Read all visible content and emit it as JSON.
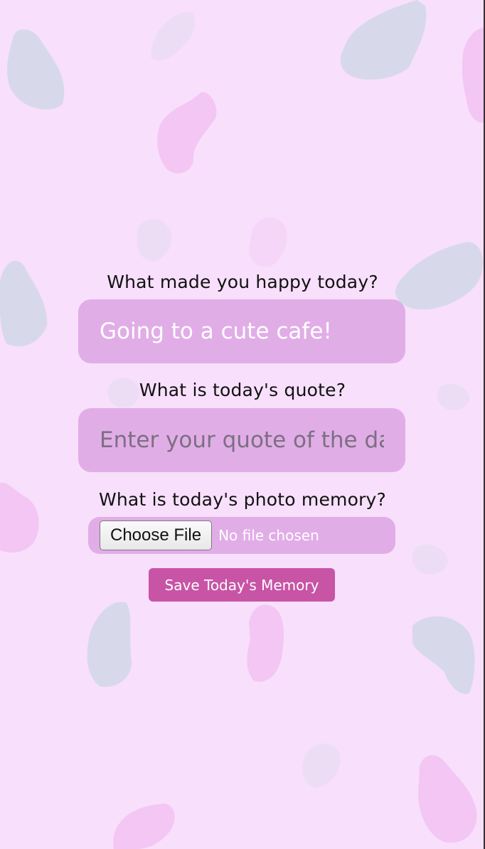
{
  "colors": {
    "background": "#f8dffb",
    "input_background": "#e1ade7",
    "button_background": "#c854a6",
    "pink_blob": "#f3c6f4",
    "blue_blob": "#d7d9ea"
  },
  "form": {
    "happy": {
      "label": "What made you happy today?",
      "value": "Going to a cute cafe!"
    },
    "quote": {
      "label": "What is today's quote?",
      "placeholder": "Enter your quote of the day"
    },
    "photo": {
      "label": "What is today's photo memory?",
      "button_label": "Choose File",
      "status": "No file chosen"
    },
    "save_label": "Save Today's Memory"
  }
}
